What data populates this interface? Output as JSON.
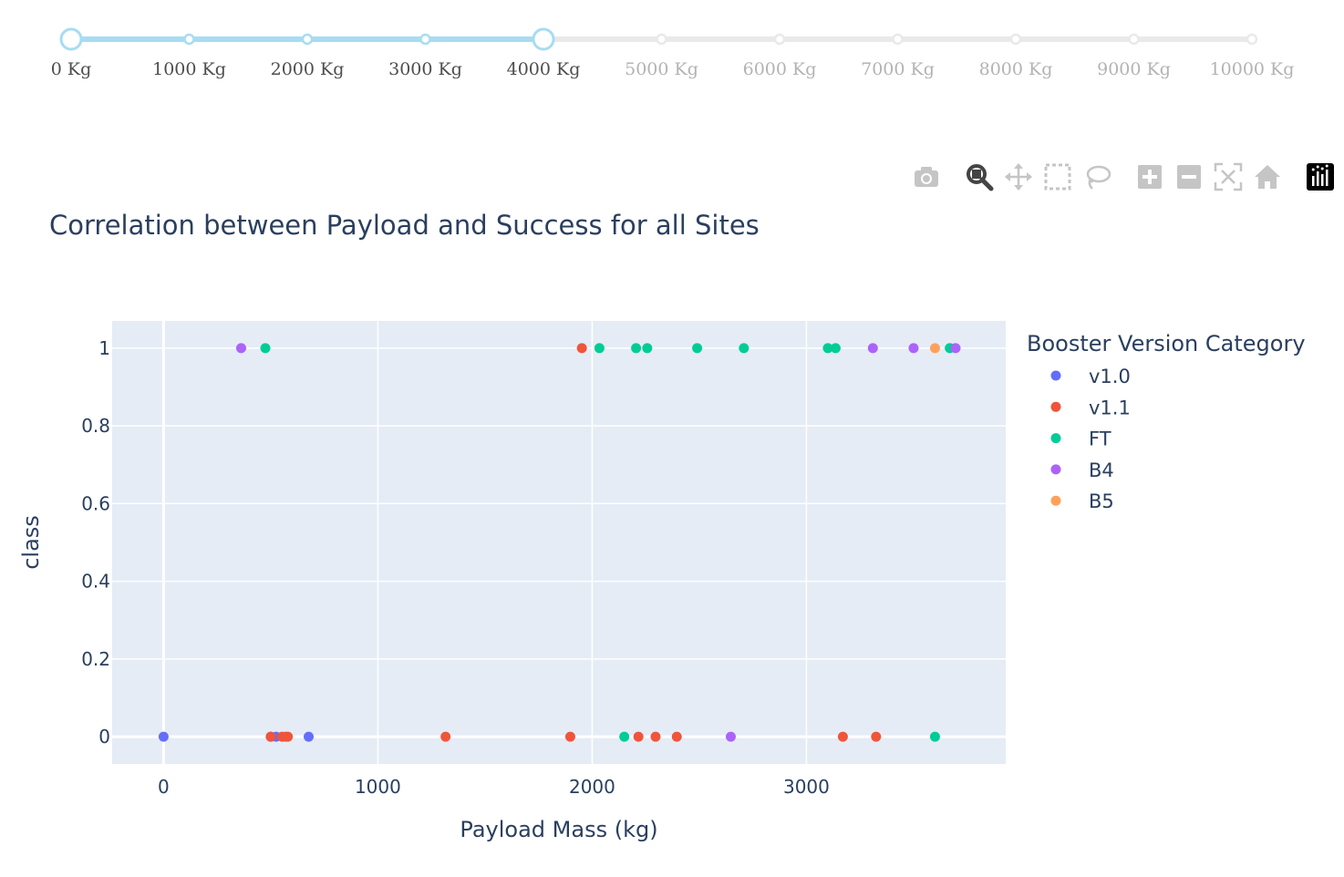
{
  "range_slider": {
    "selected_range": [
      0,
      4000
    ],
    "marks": [
      {
        "label": "0 Kg"
      },
      {
        "label": "1000 Kg"
      },
      {
        "label": "2000 Kg"
      },
      {
        "label": "3000 Kg"
      },
      {
        "label": "4000 Kg"
      },
      {
        "label": "5000 Kg"
      },
      {
        "label": "6000 Kg"
      },
      {
        "label": "7000 Kg"
      },
      {
        "label": "8000 Kg"
      },
      {
        "label": "9000 Kg"
      },
      {
        "label": "10000 Kg"
      }
    ],
    "min": 0,
    "max": 10000,
    "active_color": "#a7dcf2",
    "active_handle_color": "#a7dcf2",
    "inactive_color": "#e9e9e9",
    "active_label_color": "#4d4d4d",
    "inactive_label_color": "#b3b3b3"
  },
  "modebar": {
    "buttons": [
      {
        "name": "camera-icon",
        "title": "Download plot as a png"
      },
      {
        "name": "zoom-icon",
        "title": "Zoom",
        "active": true
      },
      {
        "name": "pan-icon",
        "title": "Pan"
      },
      {
        "name": "box-select-icon",
        "title": "Box Select"
      },
      {
        "name": "lasso-select-icon",
        "title": "Lasso Select"
      },
      {
        "name": "zoom-in-icon",
        "title": "Zoom in"
      },
      {
        "name": "zoom-out-icon",
        "title": "Zoom out"
      },
      {
        "name": "autoscale-icon",
        "title": "Autoscale"
      },
      {
        "name": "home-icon",
        "title": "Reset axes"
      },
      {
        "name": "plotly-logo-icon",
        "title": "Produced with Plotly"
      }
    ]
  },
  "colors": {
    "plot_bg": "#e5ecf6",
    "grid": "#ffffff",
    "text": "#2a3f5f",
    "modebar_icon": "#c5c5c5",
    "modebar_active": "#444444"
  },
  "chart_data": {
    "type": "scatter",
    "title": "Correlation between Payload and Success for all Sites",
    "xlabel": "Payload Mass (kg)",
    "ylabel": "class",
    "xlim": [
      -240,
      3930
    ],
    "ylim": [
      -0.07,
      1.07
    ],
    "xticks": [
      0,
      1000,
      2000,
      3000
    ],
    "yticks": [
      0,
      0.2,
      0.4,
      0.6,
      0.8,
      1
    ],
    "ytick_labels": [
      "0",
      "0.2",
      "0.4",
      "0.6",
      "0.8",
      "1"
    ],
    "grid": true,
    "legend_title": "Booster Version Category",
    "legend_position": "right",
    "series": [
      {
        "name": "v1.0",
        "color": "#636efa",
        "x": [
          0,
          525,
          677,
          500
        ],
        "y": [
          0,
          0,
          0,
          0
        ]
      },
      {
        "name": "v1.1",
        "color": "#ef553b",
        "x": [
          500,
          553,
          570,
          580,
          1316,
          1898,
          1952,
          2216,
          2296,
          2395,
          3170,
          3325
        ],
        "y": [
          0,
          0,
          0,
          0,
          0,
          0,
          1,
          0,
          0,
          0,
          0,
          0
        ]
      },
      {
        "name": "FT",
        "color": "#00cc96",
        "x": [
          475,
          2034,
          2205,
          2257,
          2490,
          2708,
          3100,
          3136,
          3669,
          2150,
          3600
        ],
        "y": [
          1,
          1,
          1,
          1,
          1,
          1,
          1,
          1,
          1,
          0,
          0
        ]
      },
      {
        "name": "B4",
        "color": "#ab63fa",
        "x": [
          362,
          3310,
          3500,
          3696,
          2647
        ],
        "y": [
          1,
          1,
          1,
          1,
          0
        ]
      },
      {
        "name": "B5",
        "color": "#ffa15a",
        "x": [
          3600
        ],
        "y": [
          1
        ]
      }
    ]
  }
}
